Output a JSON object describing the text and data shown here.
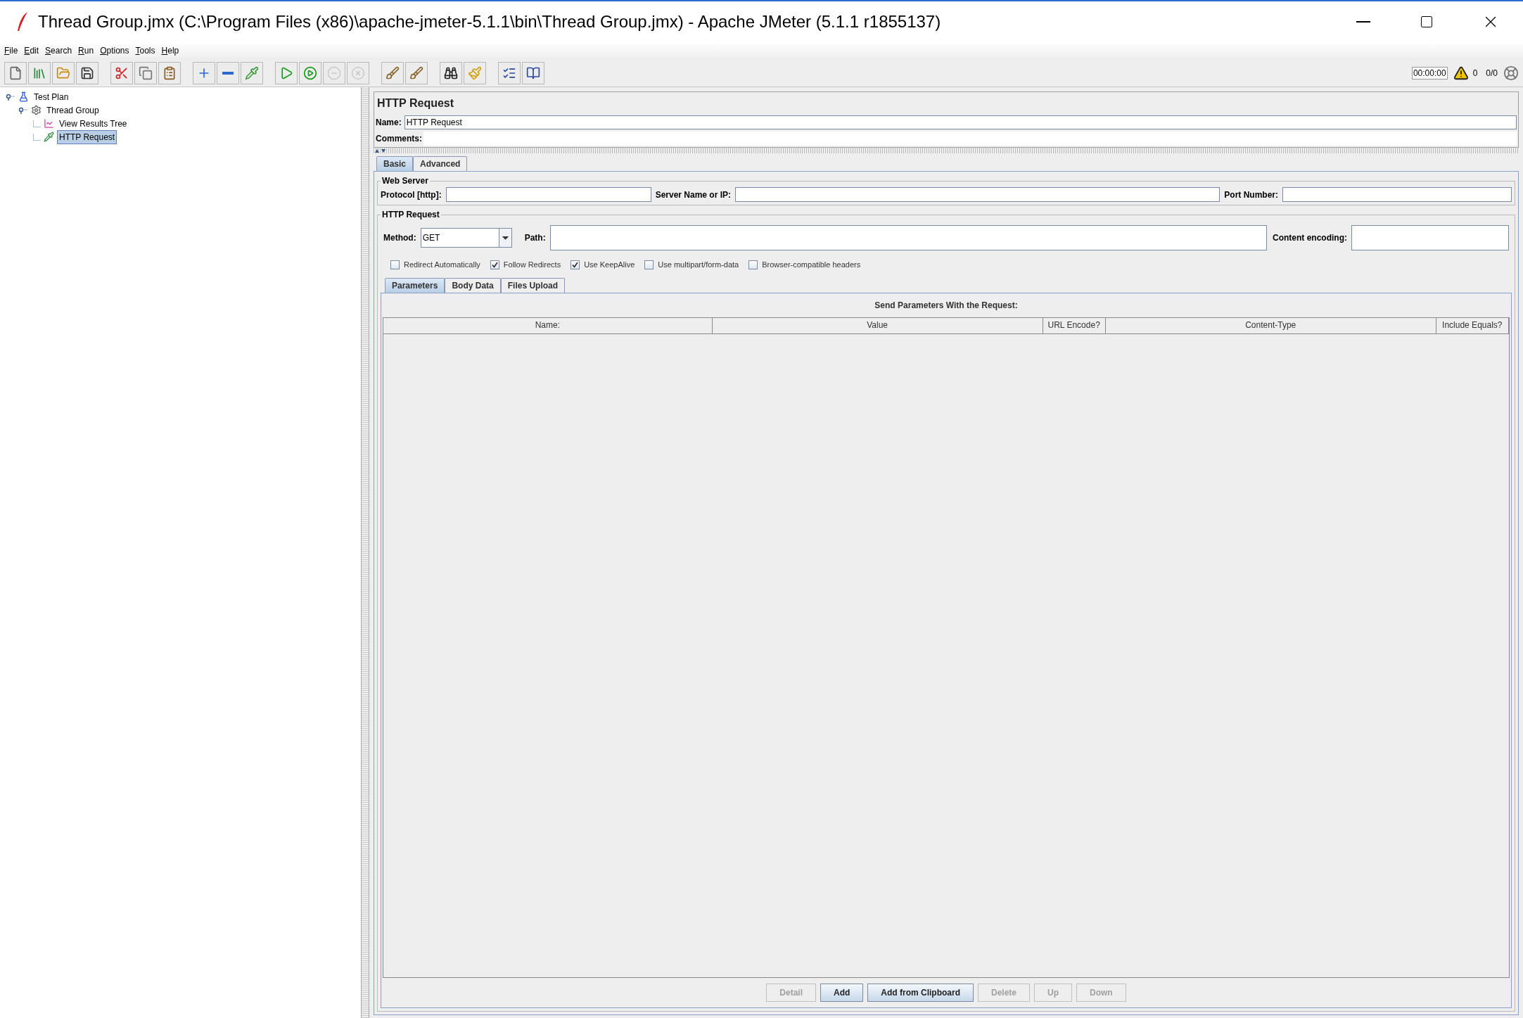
{
  "window": {
    "title": "Thread Group.jmx (C:\\Program Files (x86)\\apache-jmeter-5.1.1\\bin\\Thread Group.jmx) - Apache JMeter (5.1.1 r1855137)"
  },
  "menu": [
    {
      "label": "File"
    },
    {
      "label": "Edit"
    },
    {
      "label": "Search"
    },
    {
      "label": "Run"
    },
    {
      "label": "Options"
    },
    {
      "label": "Tools"
    },
    {
      "label": "Help"
    }
  ],
  "toolbar": [
    {
      "buttons": [
        {
          "kind": "new",
          "disabled": false
        },
        {
          "kind": "templates",
          "disabled": false
        },
        {
          "kind": "open",
          "disabled": false
        },
        {
          "kind": "save",
          "disabled": false
        }
      ]
    },
    {
      "buttons": [
        {
          "kind": "cut",
          "disabled": false
        },
        {
          "kind": "copy",
          "disabled": false
        },
        {
          "kind": "paste",
          "disabled": false
        }
      ]
    },
    {
      "buttons": [
        {
          "kind": "expand",
          "disabled": false
        },
        {
          "kind": "collapse",
          "disabled": false
        },
        {
          "kind": "toggle",
          "disabled": false
        }
      ]
    },
    {
      "buttons": [
        {
          "kind": "start",
          "disabled": false
        },
        {
          "kind": "start-no-pause",
          "disabled": false
        },
        {
          "kind": "stop",
          "disabled": true
        },
        {
          "kind": "shutdown",
          "disabled": true
        }
      ]
    },
    {
      "buttons": [
        {
          "kind": "clear",
          "disabled": false
        },
        {
          "kind": "clear-all",
          "disabled": false
        }
      ]
    },
    {
      "buttons": [
        {
          "kind": "search",
          "disabled": false
        },
        {
          "kind": "reset-search",
          "disabled": false
        }
      ]
    },
    {
      "buttons": [
        {
          "kind": "function-helper",
          "disabled": false
        },
        {
          "kind": "help",
          "disabled": false
        }
      ]
    }
  ],
  "status": {
    "timer": "00:00:00",
    "errors": "0",
    "threads": "0/0"
  },
  "tree": [
    {
      "label": "Test Plan",
      "kind": "test-plan",
      "expanded": true,
      "selected": false,
      "children": [
        {
          "label": "Thread Group",
          "kind": "thread-group",
          "expanded": true,
          "selected": false,
          "children": [
            {
              "label": "View Results Tree",
              "kind": "listener",
              "selected": false
            },
            {
              "label": "HTTP Request",
              "kind": "sampler",
              "selected": true
            }
          ]
        }
      ]
    }
  ],
  "editor": {
    "title": "HTTP Request",
    "name_label": "Name:",
    "name_value": "HTTP Request",
    "comments_label": "Comments:",
    "tabs": [
      {
        "label": "Basic",
        "selected": true
      },
      {
        "label": "Advanced",
        "selected": false
      }
    ],
    "web_server": {
      "legend": "Web Server",
      "fields": [
        {
          "label": "Protocol [http]:"
        },
        {
          "label": "Server Name or IP:"
        },
        {
          "label": "Port Number:"
        }
      ]
    },
    "http_request": {
      "legend": "HTTP Request",
      "method_label": "Method:",
      "method_value": "GET",
      "path_label": "Path:",
      "encoding_label": "Content encoding:",
      "options": [
        {
          "label": "Redirect Automatically",
          "checked": false
        },
        {
          "label": "Follow Redirects",
          "checked": true
        },
        {
          "label": "Use KeepAlive",
          "checked": true
        },
        {
          "label": "Use multipart/form-data",
          "checked": false
        },
        {
          "label": "Browser-compatible headers",
          "checked": false
        }
      ]
    },
    "sub_tabs": [
      {
        "label": "Parameters",
        "selected": true
      },
      {
        "label": "Body Data",
        "selected": false
      },
      {
        "label": "Files Upload",
        "selected": false
      }
    ],
    "parameters": {
      "heading": "Send Parameters With the Request:",
      "columns": [
        "Name:",
        "Value",
        "URL Encode?",
        "Content-Type",
        "Include Equals?"
      ]
    },
    "buttons": [
      {
        "label": "Detail",
        "disabled": true
      },
      {
        "label": "Add",
        "disabled": false
      },
      {
        "label": "Add from Clipboard",
        "disabled": false
      },
      {
        "label": "Delete",
        "disabled": true
      },
      {
        "label": "Up",
        "disabled": true
      },
      {
        "label": "Down",
        "disabled": true
      }
    ]
  }
}
